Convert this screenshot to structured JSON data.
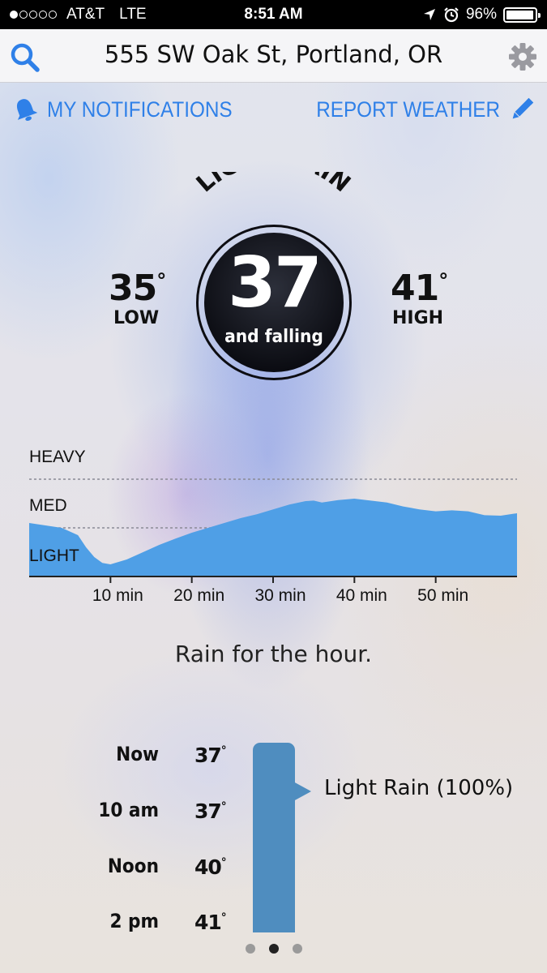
{
  "status_bar": {
    "carrier": "AT&T",
    "network": "LTE",
    "time": "8:51 AM",
    "battery_percent": "96%",
    "battery_level": 0.96,
    "signal_bars_filled": 1,
    "signal_bars_total": 5
  },
  "nav": {
    "address": "555 SW Oak St, Portland, OR",
    "search_icon": "search-icon",
    "settings_icon": "gear-icon"
  },
  "actions": {
    "notifications_label": "MY NOTIFICATIONS",
    "report_label": "REPORT WEATHER"
  },
  "current": {
    "condition": "LIGHT RAIN",
    "temp": "37",
    "trend": "and falling",
    "low": "35",
    "low_label": "LOW",
    "high": "41",
    "high_label": "HIGH"
  },
  "chart_data": {
    "type": "area",
    "title": "",
    "xlabel": "",
    "ylabel": "",
    "y_levels": [
      "LIGHT",
      "MED",
      "HEAVY"
    ],
    "x_tick_labels": [
      "10 min",
      "20 min",
      "30 min",
      "40 min",
      "50 min"
    ],
    "x_ticks": [
      10,
      20,
      30,
      40,
      50
    ],
    "xlim": [
      0,
      60
    ],
    "ylim": [
      0,
      2
    ],
    "dashed_gridlines_at": [
      1,
      2
    ],
    "color": "#4f9fe6",
    "x": [
      0,
      2,
      4,
      6,
      7,
      8,
      9,
      10,
      12,
      14,
      16,
      18,
      20,
      22,
      24,
      26,
      28,
      30,
      32,
      34,
      35,
      36,
      38,
      40,
      42,
      44,
      46,
      48,
      50,
      52,
      54,
      56,
      58,
      60
    ],
    "values": [
      1.1,
      1.05,
      1.0,
      0.85,
      0.6,
      0.4,
      0.28,
      0.25,
      0.35,
      0.5,
      0.65,
      0.78,
      0.9,
      1.0,
      1.1,
      1.2,
      1.28,
      1.38,
      1.48,
      1.55,
      1.56,
      1.52,
      1.57,
      1.6,
      1.56,
      1.52,
      1.44,
      1.38,
      1.34,
      1.36,
      1.34,
      1.26,
      1.25,
      1.3
    ]
  },
  "summary": "Rain for the hour.",
  "hourly": [
    {
      "time": "Now",
      "temp": "37"
    },
    {
      "time": "10 am",
      "temp": "37"
    },
    {
      "time": "Noon",
      "temp": "40"
    },
    {
      "time": "2 pm",
      "temp": "41"
    }
  ],
  "hourly_condition": "Light Rain (100%)",
  "hourly_bar_color": "#4f8dbf",
  "pager": {
    "pages": 3,
    "active": 2
  },
  "colors": {
    "accent": "#2f80e8",
    "circle": "#0d0d12"
  }
}
